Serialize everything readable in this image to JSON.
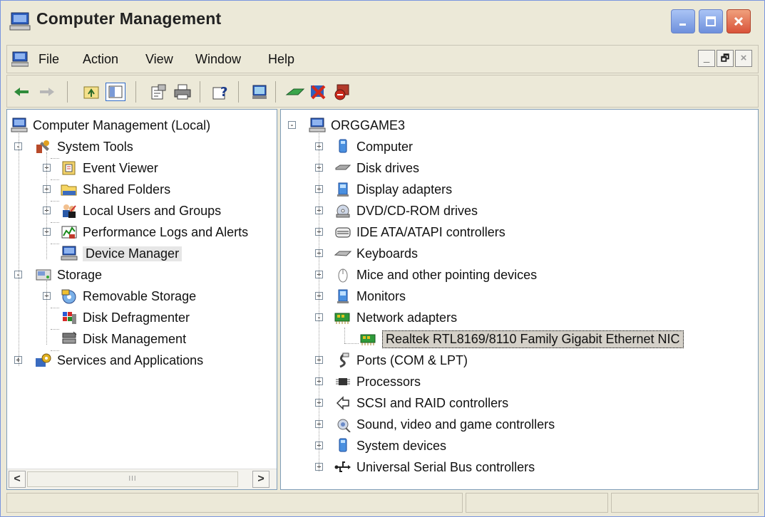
{
  "window": {
    "title": "Computer Management"
  },
  "menu": {
    "file": "File",
    "action": "Action",
    "view": "View",
    "window": "Window",
    "help": "Help"
  },
  "mdi": {
    "min": "_",
    "restore": "🗗",
    "close": "×"
  },
  "scroll": {
    "left": "<",
    "right": ">",
    "grip": "III"
  },
  "left_tree": [
    {
      "label": "Computer Management (Local)",
      "icon": "computer-icon"
    },
    {
      "label": "System Tools",
      "icon": "tools-icon"
    },
    {
      "label": "Event Viewer",
      "icon": "event-viewer-icon"
    },
    {
      "label": "Shared Folders",
      "icon": "folder-icon"
    },
    {
      "label": "Local Users and Groups",
      "icon": "users-icon"
    },
    {
      "label": "Performance Logs and Alerts",
      "icon": "performance-icon"
    },
    {
      "label": "Device Manager",
      "icon": "device-manager-icon"
    },
    {
      "label": "Storage",
      "icon": "storage-icon"
    },
    {
      "label": "Removable Storage",
      "icon": "removable-storage-icon"
    },
    {
      "label": "Disk Defragmenter",
      "icon": "defrag-icon"
    },
    {
      "label": "Disk Management",
      "icon": "disk-management-icon"
    },
    {
      "label": "Services and Applications",
      "icon": "services-icon"
    }
  ],
  "right_tree": [
    {
      "label": "ORGGAME3",
      "icon": "computer-icon"
    },
    {
      "label": "Computer",
      "icon": "computer-device-icon"
    },
    {
      "label": "Disk drives",
      "icon": "disk-drive-icon"
    },
    {
      "label": "Display adapters",
      "icon": "display-adapter-icon"
    },
    {
      "label": "DVD/CD-ROM drives",
      "icon": "cdrom-icon"
    },
    {
      "label": "IDE ATA/ATAPI controllers",
      "icon": "ide-icon"
    },
    {
      "label": "Keyboards",
      "icon": "keyboard-icon"
    },
    {
      "label": "Mice and other pointing devices",
      "icon": "mouse-icon"
    },
    {
      "label": "Monitors",
      "icon": "monitor-icon"
    },
    {
      "label": "Network adapters",
      "icon": "network-adapter-icon"
    },
    {
      "label": "Realtek RTL8169/8110 Family Gigabit Ethernet NIC",
      "icon": "network-card-icon"
    },
    {
      "label": "Ports (COM & LPT)",
      "icon": "port-icon"
    },
    {
      "label": "Processors",
      "icon": "processor-icon"
    },
    {
      "label": "SCSI and RAID controllers",
      "icon": "scsi-icon"
    },
    {
      "label": "Sound, video and game controllers",
      "icon": "sound-icon"
    },
    {
      "label": "System devices",
      "icon": "system-devices-icon"
    },
    {
      "label": "Universal Serial Bus controllers",
      "icon": "usb-icon"
    }
  ],
  "colors": {
    "selection": "#d4d0c8",
    "titlebar_close": "#d9533a",
    "pane_border": "#7f9db9"
  }
}
